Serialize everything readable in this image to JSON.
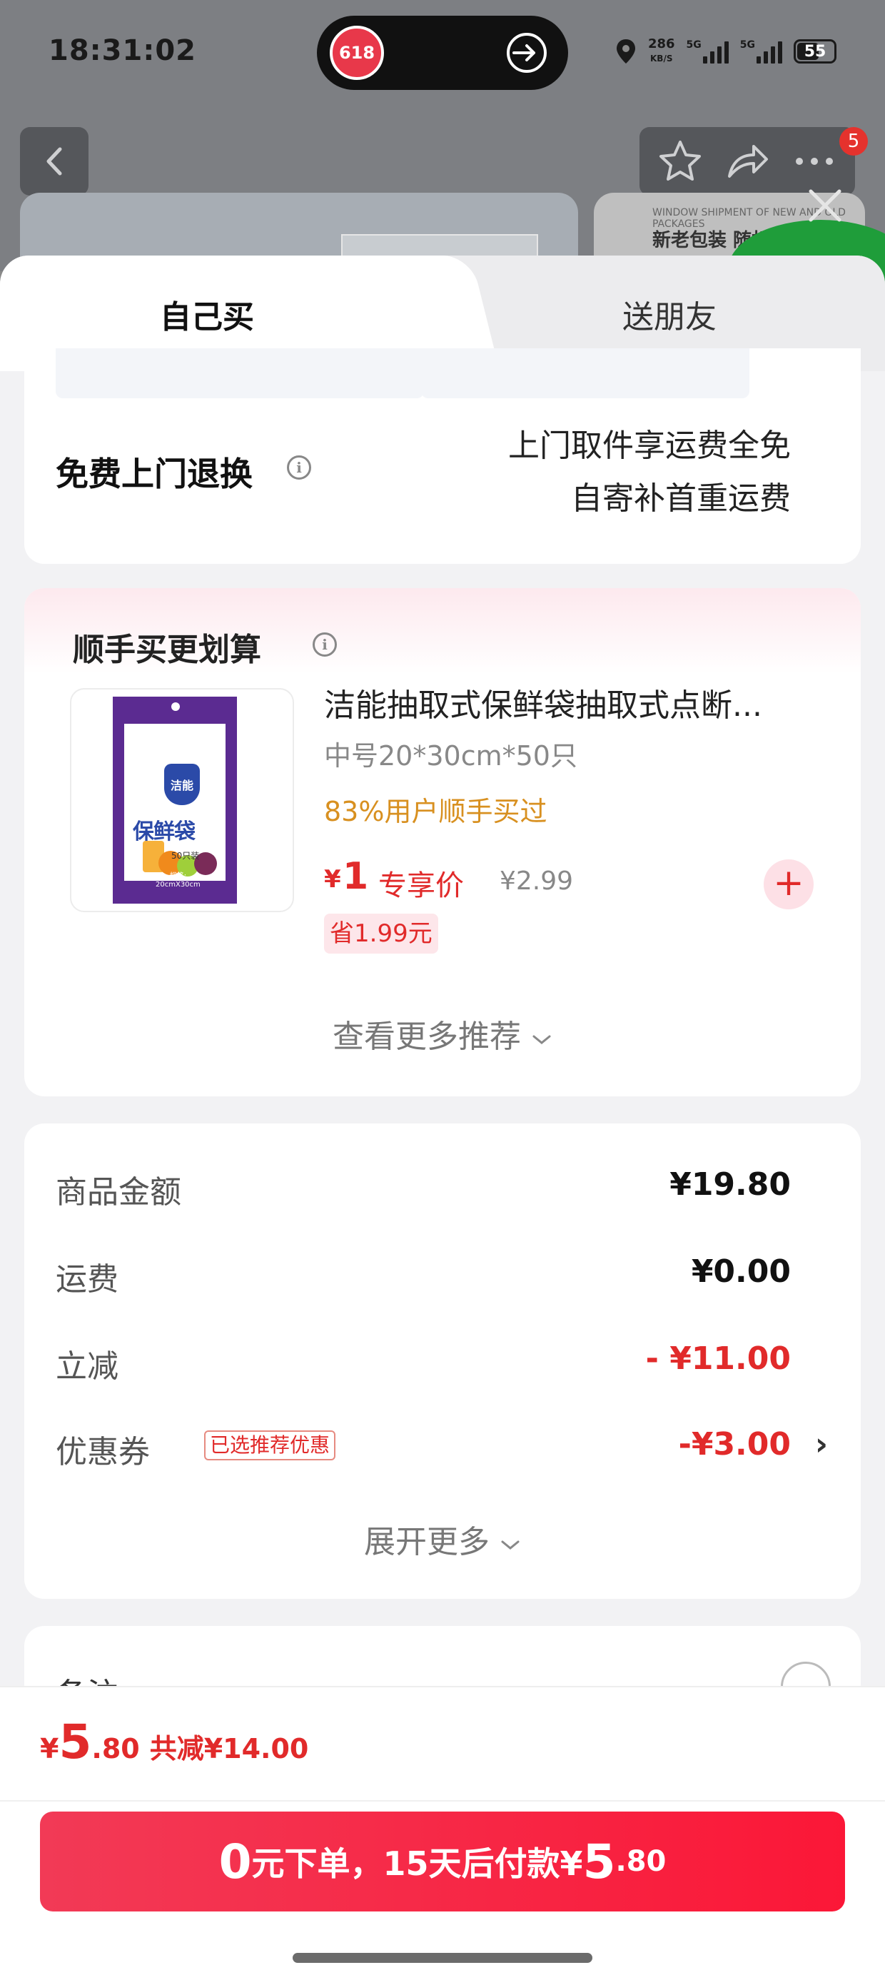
{
  "status_bar": {
    "time": "18:31:02",
    "island_logo_text": "618",
    "speed_value": "286",
    "speed_unit": "KB/S",
    "signal1_label": "5G",
    "signal2_label": "5G",
    "battery": "55"
  },
  "background": {
    "cart_badge": "5",
    "card_caption": "WINDOW SHIPMENT OF NEW AND OLD PACKAGES",
    "card_text": "新老包装 随机"
  },
  "tabs": {
    "self": "自己买",
    "gift": "送朋友"
  },
  "return_section": {
    "title": "免费上门退换",
    "line1": "上门取件享运费全免",
    "line2": "自寄补首重运费"
  },
  "addon": {
    "title": "顺手买更划算",
    "product": {
      "name": "洁能抽取式保鲜袋抽取式点断...",
      "spec": "中号20*30cm*50只",
      "social": "83%用户顺手买过",
      "currency": "¥",
      "price": "1",
      "price_label": "专享价",
      "original_price": "¥2.99",
      "saving": "省1.99元",
      "pack_brand": "洁能",
      "pack_title": "保鲜袋",
      "pack_count": "50只装",
      "pack_spec_label": "规格:",
      "pack_spec_value": "20cmX30cm"
    },
    "more_label": "查看更多推荐"
  },
  "summary": {
    "rows": [
      {
        "label": "商品金额",
        "value": "¥19.80"
      },
      {
        "label": "运费",
        "value": "¥0.00"
      },
      {
        "label": "立减",
        "value": "- ¥11.00"
      },
      {
        "label": "优惠券",
        "value": "-¥3.00",
        "tag": "已选推荐优惠"
      }
    ],
    "expand_label": "展开更多"
  },
  "note": {
    "label": "备注"
  },
  "bottom": {
    "currency": "¥",
    "total_int": "5",
    "total_dec": ".80",
    "saved": "共减¥14.00",
    "pay_big_prefix": "0",
    "pay_text": "元下单，15天后付款¥",
    "pay_big_amount": "5",
    "pay_dec": ".80"
  },
  "colors": {
    "accent_red": "#e12a2a",
    "button_red": "#fb1737",
    "social_orange": "#d89020"
  }
}
